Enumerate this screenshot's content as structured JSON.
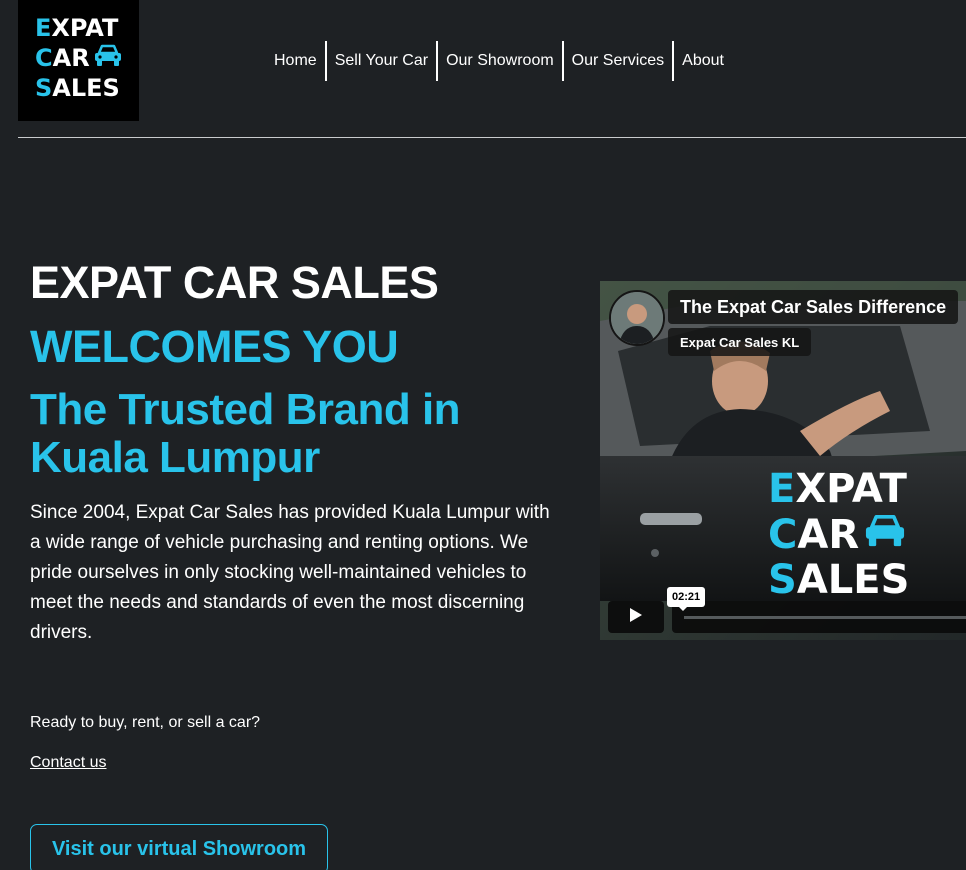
{
  "brand": {
    "logo_lines": [
      {
        "first": "E",
        "rest": "XPAT"
      },
      {
        "first": "C",
        "rest": "AR"
      },
      {
        "first": "S",
        "rest": "ALES"
      }
    ],
    "accent_color": "#29c3ea"
  },
  "nav": {
    "items": [
      "Home",
      "Sell Your Car",
      "Our Showroom",
      "Our Services",
      "About"
    ]
  },
  "hero": {
    "title": "EXPAT CAR SALES",
    "welcome": "WELCOMES YOU",
    "tagline": "The Trusted Brand in Kuala Lumpur",
    "intro": "Since 2004, Expat Car Sales has provided Kuala Lumpur with a wide range of vehicle purchasing and renting options. We pride ourselves in only stocking well-maintained vehicles to meet the needs and standards of even the most discerning drivers.",
    "cta_question": "Ready to buy, rent, or sell a car?",
    "contact_link": "Contact us",
    "showroom_button": "Visit our virtual Showroom"
  },
  "video": {
    "title": "The Expat Car Sales Difference",
    "channel": "Expat Car Sales KL",
    "logo_lines": [
      {
        "first": "E",
        "rest": "XPAT"
      },
      {
        "first": "C",
        "rest": "AR"
      },
      {
        "first": "S",
        "rest": "ALES"
      }
    ],
    "timestamp": "02:21",
    "play_icon": "play-icon"
  }
}
